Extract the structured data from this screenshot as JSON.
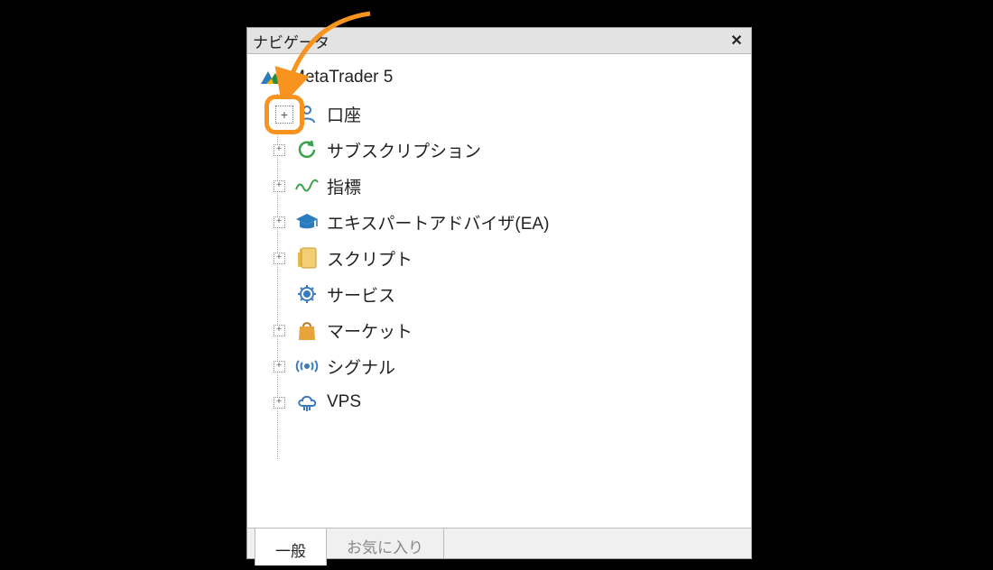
{
  "panel": {
    "title": "ナビゲータ"
  },
  "tree": {
    "root": {
      "label": "MetaTrader 5",
      "icon": "mt5-logo"
    },
    "items": [
      {
        "label": "口座",
        "icon": "person",
        "expandable": true
      },
      {
        "label": "サブスクリプション",
        "icon": "refresh",
        "expandable": true
      },
      {
        "label": "指標",
        "icon": "wave",
        "expandable": true
      },
      {
        "label": "エキスパートアドバイザ(EA)",
        "icon": "grad-cap",
        "expandable": true
      },
      {
        "label": "スクリプト",
        "icon": "script",
        "expandable": true
      },
      {
        "label": "サービス",
        "icon": "gear",
        "expandable": false
      },
      {
        "label": "マーケット",
        "icon": "bag",
        "expandable": true
      },
      {
        "label": "シグナル",
        "icon": "signal",
        "expandable": true
      },
      {
        "label": "VPS",
        "icon": "cloud",
        "expandable": true
      }
    ]
  },
  "tabs": {
    "active": "一般",
    "inactive": "お気に入り"
  },
  "annotation": {
    "target": "expand-accounts",
    "color": "#f7931e"
  }
}
